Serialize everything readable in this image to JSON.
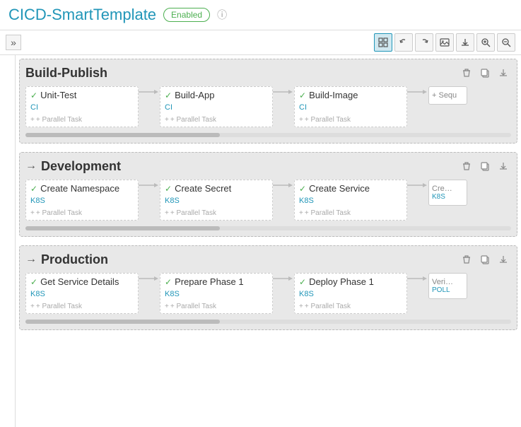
{
  "header": {
    "title": "CICD-SmartTemplate",
    "badge": "Enabled",
    "info_label": "ⓘ"
  },
  "toolbar": {
    "sidebar_toggle": "»",
    "grid_icon": "⊞",
    "undo_icon": "↩",
    "redo_icon": "↪",
    "image_icon": "🖼",
    "download_icon": "⬇",
    "zoom_in_icon": "🔍+",
    "zoom_out_icon": "🔍-"
  },
  "phases": [
    {
      "id": "build-publish",
      "title": "Build-Publish",
      "show_arrow": false,
      "tasks": [
        {
          "name": "Unit-Test",
          "type": "CI"
        },
        {
          "name": "Build-App",
          "type": "CI"
        },
        {
          "name": "Build-Image",
          "type": "CI"
        },
        {
          "name": "Sequ…",
          "type": "",
          "cutoff": true
        }
      ]
    },
    {
      "id": "development",
      "title": "Development",
      "show_arrow": true,
      "tasks": [
        {
          "name": "Create Namespace",
          "type": "K8S"
        },
        {
          "name": "Create Secret",
          "type": "K8S"
        },
        {
          "name": "Create Service",
          "type": "K8S"
        },
        {
          "name": "Cre…",
          "type": "K8S",
          "cutoff": true
        }
      ]
    },
    {
      "id": "production",
      "title": "Production",
      "show_arrow": true,
      "tasks": [
        {
          "name": "Get Service Details",
          "type": "K8S"
        },
        {
          "name": "Prepare Phase 1",
          "type": "K8S"
        },
        {
          "name": "Deploy Phase 1",
          "type": "K8S"
        },
        {
          "name": "Veri…",
          "type": "POLL",
          "cutoff": true
        }
      ]
    }
  ],
  "parallel_task_label": "+ Parallel Task",
  "colors": {
    "accent": "#2196b8",
    "success": "#4caf50",
    "text_primary": "#333",
    "border": "#ccc"
  }
}
